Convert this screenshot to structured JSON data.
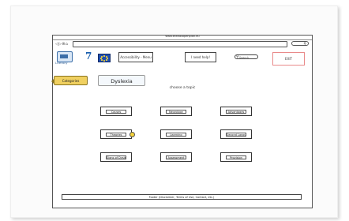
{
  "window": {
    "url": "www.thelastopenplan.eu"
  },
  "header": {
    "logo_label": "Literacy",
    "flag_seven": "7",
    "accessibility_label": "Accessibility - Menu",
    "help_label": "I need help!",
    "search_placeholder": "Search",
    "exit_label": "EXIT"
  },
  "nav": {
    "categories_label": "Categories"
  },
  "main": {
    "section_title": "Dyslexia",
    "prompt": "choose a topic",
    "topics": [
      "Causes",
      "Neurology",
      "Advantages",
      "Theories",
      "Learning",
      "Second Language",
      "Signs of Dyslexia",
      "Assessment",
      "Provision"
    ]
  },
  "footer": {
    "text": "Footer (Disclaimer, Terms of Use, Contact, etc.)"
  }
}
